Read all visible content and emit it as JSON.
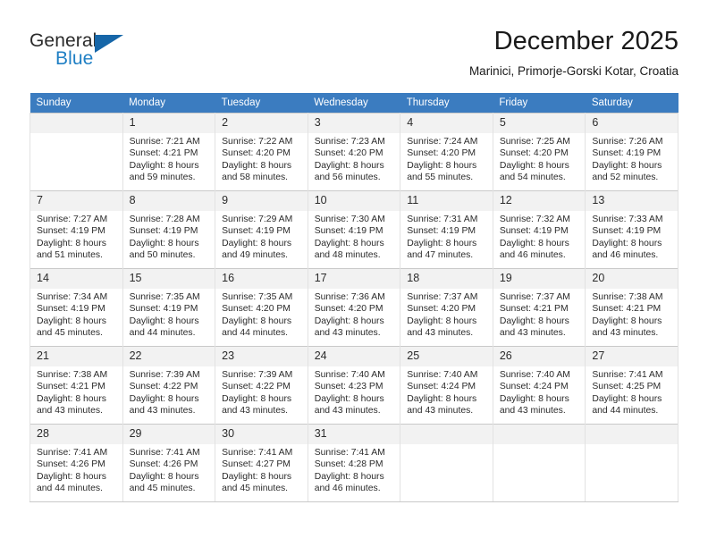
{
  "brand": {
    "name_part1": "General",
    "name_part2": "Blue",
    "flag_icon": "blue-flag-icon"
  },
  "header": {
    "title": "December 2025",
    "subtitle": "Marinici, Primorje-Gorski Kotar, Croatia"
  },
  "colors": {
    "header_row_bg": "#3b7cc0",
    "brand_blue": "#1f7fc4",
    "daynum_bg": "#f2f2f2",
    "grid_border": "#c9c9c9"
  },
  "calendar": {
    "weekdays": [
      "Sunday",
      "Monday",
      "Tuesday",
      "Wednesday",
      "Thursday",
      "Friday",
      "Saturday"
    ],
    "weeks": [
      [
        {
          "day": ""
        },
        {
          "day": "1",
          "sunrise": "Sunrise: 7:21 AM",
          "sunset": "Sunset: 4:21 PM",
          "daylight_1": "Daylight: 8 hours",
          "daylight_2": "and 59 minutes."
        },
        {
          "day": "2",
          "sunrise": "Sunrise: 7:22 AM",
          "sunset": "Sunset: 4:20 PM",
          "daylight_1": "Daylight: 8 hours",
          "daylight_2": "and 58 minutes."
        },
        {
          "day": "3",
          "sunrise": "Sunrise: 7:23 AM",
          "sunset": "Sunset: 4:20 PM",
          "daylight_1": "Daylight: 8 hours",
          "daylight_2": "and 56 minutes."
        },
        {
          "day": "4",
          "sunrise": "Sunrise: 7:24 AM",
          "sunset": "Sunset: 4:20 PM",
          "daylight_1": "Daylight: 8 hours",
          "daylight_2": "and 55 minutes."
        },
        {
          "day": "5",
          "sunrise": "Sunrise: 7:25 AM",
          "sunset": "Sunset: 4:20 PM",
          "daylight_1": "Daylight: 8 hours",
          "daylight_2": "and 54 minutes."
        },
        {
          "day": "6",
          "sunrise": "Sunrise: 7:26 AM",
          "sunset": "Sunset: 4:19 PM",
          "daylight_1": "Daylight: 8 hours",
          "daylight_2": "and 52 minutes."
        }
      ],
      [
        {
          "day": "7",
          "sunrise": "Sunrise: 7:27 AM",
          "sunset": "Sunset: 4:19 PM",
          "daylight_1": "Daylight: 8 hours",
          "daylight_2": "and 51 minutes."
        },
        {
          "day": "8",
          "sunrise": "Sunrise: 7:28 AM",
          "sunset": "Sunset: 4:19 PM",
          "daylight_1": "Daylight: 8 hours",
          "daylight_2": "and 50 minutes."
        },
        {
          "day": "9",
          "sunrise": "Sunrise: 7:29 AM",
          "sunset": "Sunset: 4:19 PM",
          "daylight_1": "Daylight: 8 hours",
          "daylight_2": "and 49 minutes."
        },
        {
          "day": "10",
          "sunrise": "Sunrise: 7:30 AM",
          "sunset": "Sunset: 4:19 PM",
          "daylight_1": "Daylight: 8 hours",
          "daylight_2": "and 48 minutes."
        },
        {
          "day": "11",
          "sunrise": "Sunrise: 7:31 AM",
          "sunset": "Sunset: 4:19 PM",
          "daylight_1": "Daylight: 8 hours",
          "daylight_2": "and 47 minutes."
        },
        {
          "day": "12",
          "sunrise": "Sunrise: 7:32 AM",
          "sunset": "Sunset: 4:19 PM",
          "daylight_1": "Daylight: 8 hours",
          "daylight_2": "and 46 minutes."
        },
        {
          "day": "13",
          "sunrise": "Sunrise: 7:33 AM",
          "sunset": "Sunset: 4:19 PM",
          "daylight_1": "Daylight: 8 hours",
          "daylight_2": "and 46 minutes."
        }
      ],
      [
        {
          "day": "14",
          "sunrise": "Sunrise: 7:34 AM",
          "sunset": "Sunset: 4:19 PM",
          "daylight_1": "Daylight: 8 hours",
          "daylight_2": "and 45 minutes."
        },
        {
          "day": "15",
          "sunrise": "Sunrise: 7:35 AM",
          "sunset": "Sunset: 4:19 PM",
          "daylight_1": "Daylight: 8 hours",
          "daylight_2": "and 44 minutes."
        },
        {
          "day": "16",
          "sunrise": "Sunrise: 7:35 AM",
          "sunset": "Sunset: 4:20 PM",
          "daylight_1": "Daylight: 8 hours",
          "daylight_2": "and 44 minutes."
        },
        {
          "day": "17",
          "sunrise": "Sunrise: 7:36 AM",
          "sunset": "Sunset: 4:20 PM",
          "daylight_1": "Daylight: 8 hours",
          "daylight_2": "and 43 minutes."
        },
        {
          "day": "18",
          "sunrise": "Sunrise: 7:37 AM",
          "sunset": "Sunset: 4:20 PM",
          "daylight_1": "Daylight: 8 hours",
          "daylight_2": "and 43 minutes."
        },
        {
          "day": "19",
          "sunrise": "Sunrise: 7:37 AM",
          "sunset": "Sunset: 4:21 PM",
          "daylight_1": "Daylight: 8 hours",
          "daylight_2": "and 43 minutes."
        },
        {
          "day": "20",
          "sunrise": "Sunrise: 7:38 AM",
          "sunset": "Sunset: 4:21 PM",
          "daylight_1": "Daylight: 8 hours",
          "daylight_2": "and 43 minutes."
        }
      ],
      [
        {
          "day": "21",
          "sunrise": "Sunrise: 7:38 AM",
          "sunset": "Sunset: 4:21 PM",
          "daylight_1": "Daylight: 8 hours",
          "daylight_2": "and 43 minutes."
        },
        {
          "day": "22",
          "sunrise": "Sunrise: 7:39 AM",
          "sunset": "Sunset: 4:22 PM",
          "daylight_1": "Daylight: 8 hours",
          "daylight_2": "and 43 minutes."
        },
        {
          "day": "23",
          "sunrise": "Sunrise: 7:39 AM",
          "sunset": "Sunset: 4:22 PM",
          "daylight_1": "Daylight: 8 hours",
          "daylight_2": "and 43 minutes."
        },
        {
          "day": "24",
          "sunrise": "Sunrise: 7:40 AM",
          "sunset": "Sunset: 4:23 PM",
          "daylight_1": "Daylight: 8 hours",
          "daylight_2": "and 43 minutes."
        },
        {
          "day": "25",
          "sunrise": "Sunrise: 7:40 AM",
          "sunset": "Sunset: 4:24 PM",
          "daylight_1": "Daylight: 8 hours",
          "daylight_2": "and 43 minutes."
        },
        {
          "day": "26",
          "sunrise": "Sunrise: 7:40 AM",
          "sunset": "Sunset: 4:24 PM",
          "daylight_1": "Daylight: 8 hours",
          "daylight_2": "and 43 minutes."
        },
        {
          "day": "27",
          "sunrise": "Sunrise: 7:41 AM",
          "sunset": "Sunset: 4:25 PM",
          "daylight_1": "Daylight: 8 hours",
          "daylight_2": "and 44 minutes."
        }
      ],
      [
        {
          "day": "28",
          "sunrise": "Sunrise: 7:41 AM",
          "sunset": "Sunset: 4:26 PM",
          "daylight_1": "Daylight: 8 hours",
          "daylight_2": "and 44 minutes."
        },
        {
          "day": "29",
          "sunrise": "Sunrise: 7:41 AM",
          "sunset": "Sunset: 4:26 PM",
          "daylight_1": "Daylight: 8 hours",
          "daylight_2": "and 45 minutes."
        },
        {
          "day": "30",
          "sunrise": "Sunrise: 7:41 AM",
          "sunset": "Sunset: 4:27 PM",
          "daylight_1": "Daylight: 8 hours",
          "daylight_2": "and 45 minutes."
        },
        {
          "day": "31",
          "sunrise": "Sunrise: 7:41 AM",
          "sunset": "Sunset: 4:28 PM",
          "daylight_1": "Daylight: 8 hours",
          "daylight_2": "and 46 minutes."
        },
        {
          "day": ""
        },
        {
          "day": ""
        },
        {
          "day": ""
        }
      ]
    ]
  }
}
